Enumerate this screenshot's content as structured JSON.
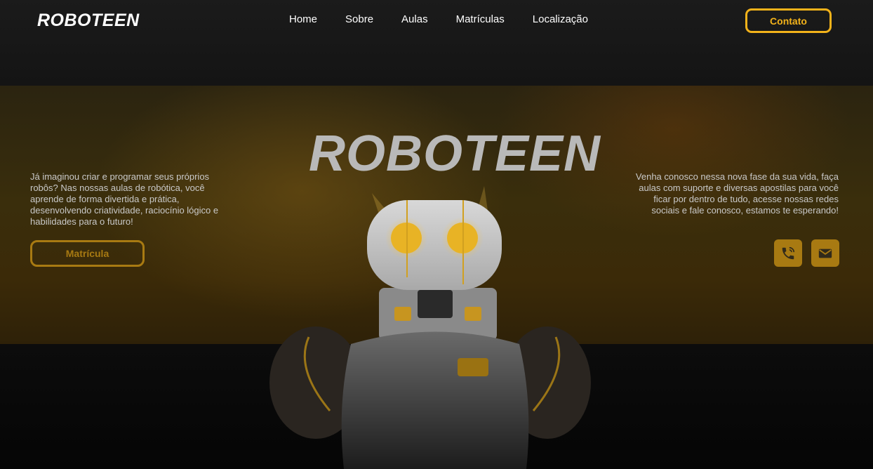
{
  "header": {
    "logo": "ROBOTEEN",
    "nav": [
      "Home",
      "Sobre",
      "Aulas",
      "Matrículas",
      "Localização"
    ],
    "contact_label": "Contato"
  },
  "hero": {
    "title": "ROBOTEEN",
    "left_text": "Já imaginou criar e programar seus próprios robôs? Nas nossas aulas de robótica, você aprende de forma divertida e prática, desenvolvendo criatividade, raciocínio lógico e habilidades para o futuro!",
    "enroll_label": "Matrícula",
    "right_text": "Venha conosco nessa nova fase da sua vida, faça aulas com suporte e diversas apostilas para você ficar por dentro de tudo, acesse nossas redes sociais e fale conosco, estamos te esperando!",
    "icons": [
      "phone-icon",
      "mail-icon"
    ]
  },
  "colors": {
    "accent": "#f2b21a",
    "accent_dim": "#a87a12",
    "background": "#121212"
  }
}
